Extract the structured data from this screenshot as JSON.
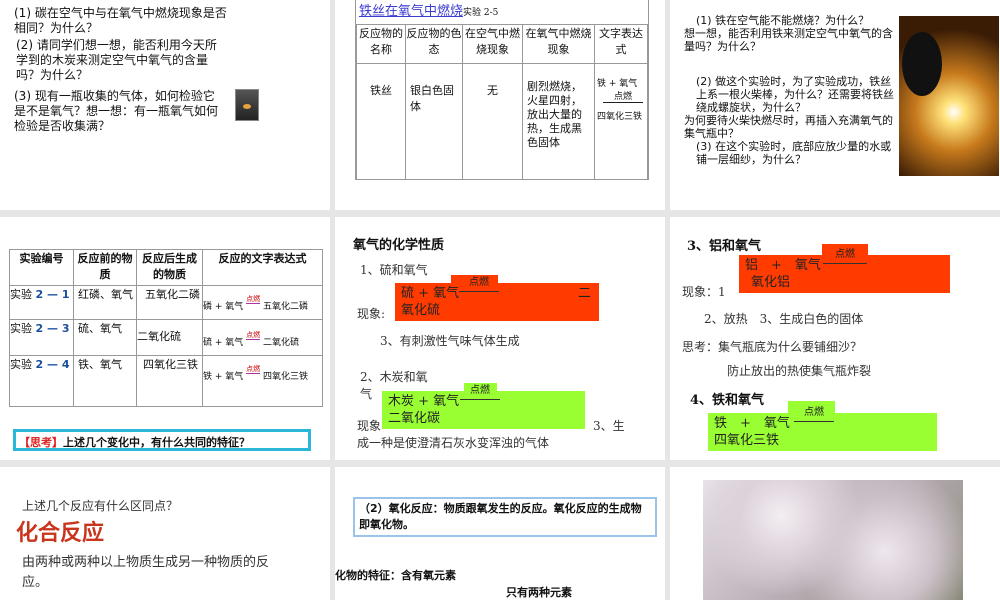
{
  "slide1": {
    "q1": "(1) 碳在空气中与在氧气中燃烧现象是否相同？为什么？",
    "q2": "(2) 请同学们想一想，能否利用今天所学到的木炭来测定空气中氧气的含量吗？为什么？",
    "q3": "(3) 现有一瓶收集的气体，如何检验它是不是氧气？想一想：有一瓶氧气如何检验是否收集满？"
  },
  "slide2": {
    "title": "铁丝在氧气中燃烧",
    "subtitle": "实验 2-5",
    "headers": [
      "反应物的名称",
      "反应物的色态",
      "在空气中燃烧现象",
      "在氧气中燃烧现象",
      "文字表达式"
    ],
    "row": [
      "铁丝",
      "银白色固体",
      "无",
      "剧烈燃烧，火星四射，放出大量的热，生成黑色固体"
    ],
    "eq_left": "铁 + 氧气",
    "eq_cond": "点燃",
    "eq_right": "四氧化三铁"
  },
  "slide3": {
    "b1": "(1) 铁在空气能不能燃烧？为什么？",
    "t1": "想一想，能否利用铁来测定空气中氧气的含量吗？为什么？",
    "b2": "(2) 做这个实验时，为了实验成功，铁丝上系一根火柴棒，为什么？还需要将铁丝绕成螺旋状，为什么？",
    "t2": "为何要待火柴快燃尽时，再插入充满氧气的集气瓶中？",
    "b3": "(3) 在这个实验时，底部应放少量的水或铺一层细纱，为什么？"
  },
  "slide4": {
    "headers": [
      "实验编号",
      "反应前的物质",
      "反应后生成的物质",
      "反应的文字表达式"
    ],
    "rows": [
      {
        "id_prefix": "实验",
        "id": "2 — 1",
        "before": "红磷、氧气",
        "after": "五氧化二磷",
        "eq_left": "磷 + 氧气",
        "cond": "点燃",
        "eq_right": "五氧化二磷"
      },
      {
        "id_prefix": "实验",
        "id": "2 — 3",
        "before": "硫、氧气",
        "after": "二氧化硫",
        "eq_left": "硫 + 氧气",
        "cond": "点燃",
        "eq_right": "二氧化硫"
      },
      {
        "id_prefix": "实验",
        "id": "2 — 4",
        "before": "铁、氧气",
        "after": "四氧化三铁",
        "eq_left": "铁 + 氧气",
        "cond": "点燃",
        "eq_right": "四氧化三铁"
      }
    ],
    "think_tag": "【思考】",
    "think": "上述几个变化中，有什么共同的特征？"
  },
  "slide5": {
    "title": "氧气的化学性质",
    "s1": "1、硫和氧气",
    "eq1_left": "硫 + 氧气",
    "cond": "点燃",
    "eq1_right_a": "二",
    "eq1_right_b": "氧化硫",
    "phen_label": "现象:",
    "p3": "3、有刺激性气味气体生成",
    "s2a": "2、木炭和氧",
    "s2b": "气",
    "eq2_left": "木炭 + 氧气",
    "eq2_right": "二氧化碳",
    "p_label2": "现象",
    "p2_tail": "3、生",
    "p2_line2": "成一种是使澄清石灰水变浑浊的气体"
  },
  "slide6": {
    "s3": "3、铝和氧气",
    "eq3_left": "铝　+　氧气",
    "cond": "点燃",
    "eq3_right": "氧化铝",
    "phen": "现象：1",
    "p2": "2、放热　3、生成白色的固体",
    "think": "思考：集气瓶底为什么要铺细沙？",
    "answer": "防止放出的热使集气瓶炸裂",
    "s4": "4、铁和氧气",
    "eq4_left": "铁　+　氧气",
    "eq4_right": "四氧化三铁"
  },
  "slide7": {
    "question": "上述几个反应有什么区同点？",
    "title": "化合反应",
    "def": "由两种或两种以上物质生成另一种物质的反应。"
  },
  "slide8": {
    "box": "（2）氧化反应：物质跟氧发生的反应。氧化反应的生成物即氧化物。",
    "f1": "化物的特征：含有氧元素",
    "f2": "只有两种元素"
  },
  "colors": {
    "red": "#ff3b00",
    "green": "#99ff33",
    "title_red": "#c8341c",
    "cyan": "#2ab7d8"
  }
}
